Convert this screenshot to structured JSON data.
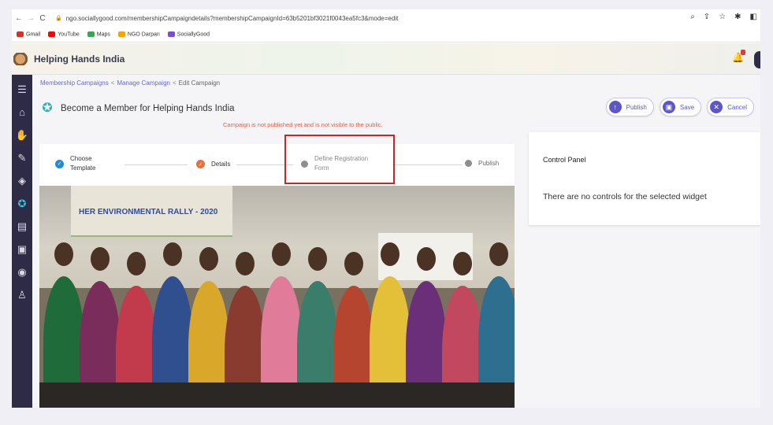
{
  "browser": {
    "url": "ngo.sociallygood.com/membershipCampaigndetails?membershipCampaignId=63b5201bf3021f0043ea5fc3&mode=edit",
    "bookmarks": [
      {
        "label": "Gmail",
        "color": "#d93025"
      },
      {
        "label": "YouTube",
        "color": "#ff0000"
      },
      {
        "label": "Maps",
        "color": "#34a853"
      },
      {
        "label": "NGO Darpan",
        "color": "#f4a300"
      },
      {
        "label": "SociallyGood",
        "color": "#7b4cd8"
      }
    ]
  },
  "header": {
    "org_name": "Helping Hands India",
    "notification_badge": "1"
  },
  "breadcrumb": {
    "item1": "Membership Campaigns",
    "item2": "Manage Campaign",
    "current": "Edit Campaign",
    "separator": "<"
  },
  "campaign": {
    "title": "Become a Member for Helping Hands India",
    "warning": "Campaign is not published yet and is not visible to the public."
  },
  "actions": {
    "publish": "Publish",
    "save": "Save",
    "cancel": "Cancel"
  },
  "steps": [
    {
      "label_line1": "Choose",
      "label_line2": "Template",
      "state": "done",
      "color": "#1e88e5"
    },
    {
      "label_line1": "Details",
      "label_line2": "",
      "state": "in-progress",
      "color": "#ef6c3c"
    },
    {
      "label_line1": "Define Registration",
      "label_line2": "Form",
      "state": "pending",
      "color": "#8e8e8e"
    },
    {
      "label_line1": "Publish",
      "label_line2": "",
      "state": "pending",
      "color": "#8e8e8e"
    }
  ],
  "photo": {
    "banner_text": "HER ENVIRONMENTAL RALLY - 2020"
  },
  "control_panel": {
    "title": "Control Panel",
    "message": "There are no controls for the selected widget"
  },
  "sidebar_icons": [
    "menu-icon",
    "home-icon",
    "hands-icon",
    "fundraise-icon",
    "diamond-icon",
    "ribbon-icon",
    "directory-icon",
    "ngo-icon",
    "csr-icon",
    "users-icon"
  ],
  "colors": {
    "sidebar": "#2d2b46",
    "accent": "#5c56c9",
    "active_icon": "#38c6d9",
    "warning": "#e25c4a",
    "highlight_box": "#c62828"
  }
}
